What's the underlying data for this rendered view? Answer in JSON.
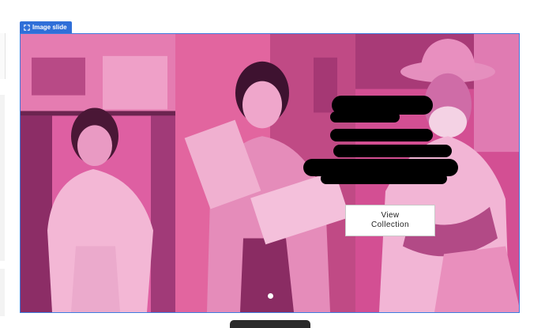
{
  "editor": {
    "slide_tag_label": "Image slide"
  },
  "slide": {
    "cta_label": "View\nCollection",
    "pagination": {
      "total": 1,
      "active": 1
    }
  },
  "colors": {
    "accent": "#2f6fd8",
    "frame_border": "#3d7ce0",
    "overlay_pink": "#d9569a",
    "cta_background": "#ffffff"
  },
  "icons": {
    "slide_tag_icon": "expand-corners-icon"
  }
}
